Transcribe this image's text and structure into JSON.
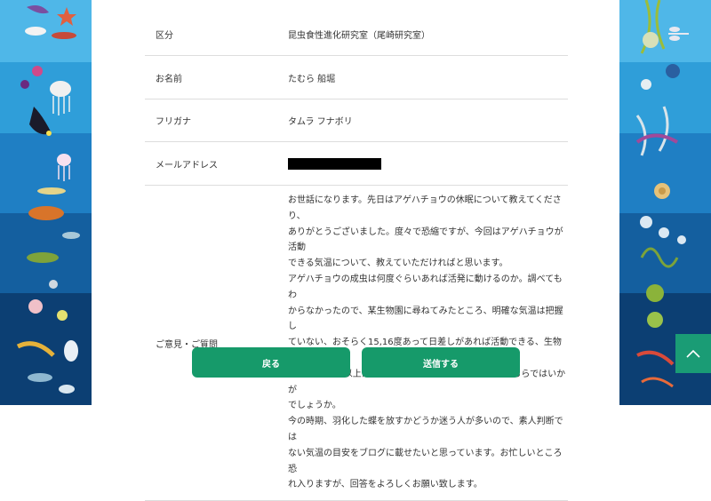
{
  "form": {
    "rows": [
      {
        "label": "区分",
        "value": "昆虫食性進化研究室（尾崎研究室）"
      },
      {
        "label": "お名前",
        "value": "たむら 船堀"
      },
      {
        "label": "フリガナ",
        "value": "タムラ フナボリ"
      },
      {
        "label": "メールアドレス",
        "value": ""
      },
      {
        "label": "ご意見・ご質問",
        "value": ""
      }
    ],
    "message_lines": [
      "お世話になります。先日はアゲハチョウの休眠について教えてくださり、",
      "ありがとうございました。度々で恐縮ですが、今回はアゲハチョウが活動",
      "できる気温について、教えていただければと思います。",
      "アゲハチョウの成虫は何度ぐらいあれば活発に動けるのか。調べてもわ",
      "からなかったので、某生物園に尋ねてみたところ、明確な気温は把握し",
      "ていない、おそらく15,16度あって日差しがあれば活動できる、生物園",
      "の温室は18度以上に設定しているという回答でした。そちらではいかが",
      "でしょうか。",
      "今の時期、羽化した蝶を放すかどうか迷う人が多いので、素人判断では",
      "ない気温の目安をブログに載せたいと思っています。お忙しいところ恐",
      "れ入りますが、回答をよろしくお願い致します。"
    ]
  },
  "buttons": {
    "back": "戻る",
    "send": "送信する"
  },
  "icons": {
    "to_top": "chevron-up-icon",
    "email_redaction": "redacted-email"
  },
  "colors": {
    "button_green": "#169a6a",
    "to_top_green": "#1a9c75",
    "divider": "#dddddd"
  }
}
